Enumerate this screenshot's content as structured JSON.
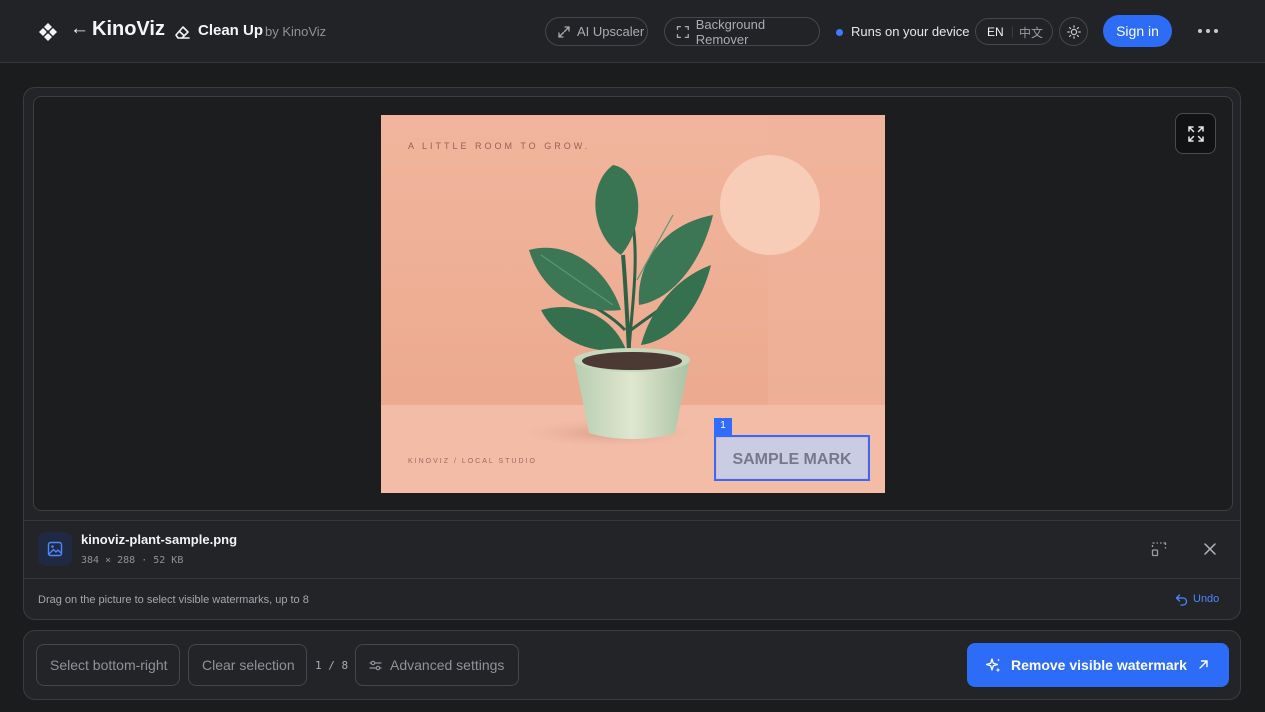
{
  "header": {
    "back_glyph": "←",
    "brand": "KinoViz",
    "tool_title": "Clean Up",
    "tool_by": "by KinoViz",
    "nav": [
      {
        "label": "AI Upscaler",
        "icon": "expand-diagonal-icon"
      },
      {
        "label": "Background Remover",
        "icon": "selection-frame-icon"
      }
    ],
    "status": "Runs on your device",
    "languages": [
      "EN",
      "中文"
    ],
    "theme_icon": "sun-icon",
    "signin": "Sign in",
    "more_icon": "more-horizontal-icon"
  },
  "image": {
    "headline": "A LITTLE ROOM TO GROW.",
    "footer_text": "KINOVIZ / LOCAL STUDIO",
    "watermark_text": "SAMPLE MARK",
    "selection_index": "1"
  },
  "file": {
    "name": "kinoviz-plant-sample.png",
    "meta": "384 × 288 · 52 KB",
    "icon": "image-file-icon"
  },
  "hint": "Drag on the picture to select visible watermarks, up to 8",
  "undo": "Undo",
  "toolbar": {
    "select_bottom_right": "Select bottom-right",
    "clear_selection": "Clear selection",
    "count": "1 / 8",
    "advanced": "Advanced settings",
    "remove": "Remove visible watermark"
  },
  "colors": {
    "accent": "#2d6cf6",
    "background": "#1b1c1e",
    "photo_wall": "#efb39b"
  }
}
